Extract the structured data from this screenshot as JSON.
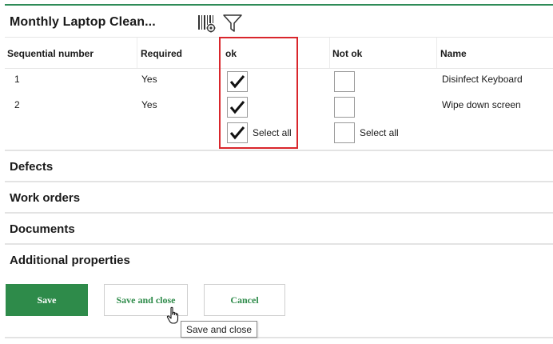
{
  "header": {
    "title": "Monthly Laptop Clean...",
    "icons": [
      "barcode-settings-icon",
      "filter-icon"
    ]
  },
  "table": {
    "columns": [
      "Sequential number",
      "Required",
      "ok",
      "Not ok",
      "Name"
    ],
    "rows": [
      {
        "seq": "1",
        "required": "Yes",
        "ok": true,
        "not_ok": false,
        "name": "Disinfect Keyboard"
      },
      {
        "seq": "2",
        "required": "Yes",
        "ok": true,
        "not_ok": false,
        "name": "Wipe down screen"
      }
    ],
    "select_all_ok": {
      "checked": true,
      "label": "Select all"
    },
    "select_all_not_ok": {
      "checked": false,
      "label": "Select all"
    }
  },
  "sections": [
    "Defects",
    "Work orders",
    "Documents",
    "Additional properties"
  ],
  "buttons": {
    "save": "Save",
    "save_and_close": "Save and close",
    "cancel": "Cancel"
  },
  "tooltip": "Save and close",
  "colors": {
    "accent": "#2e8b4a",
    "highlight": "#d9262c"
  }
}
